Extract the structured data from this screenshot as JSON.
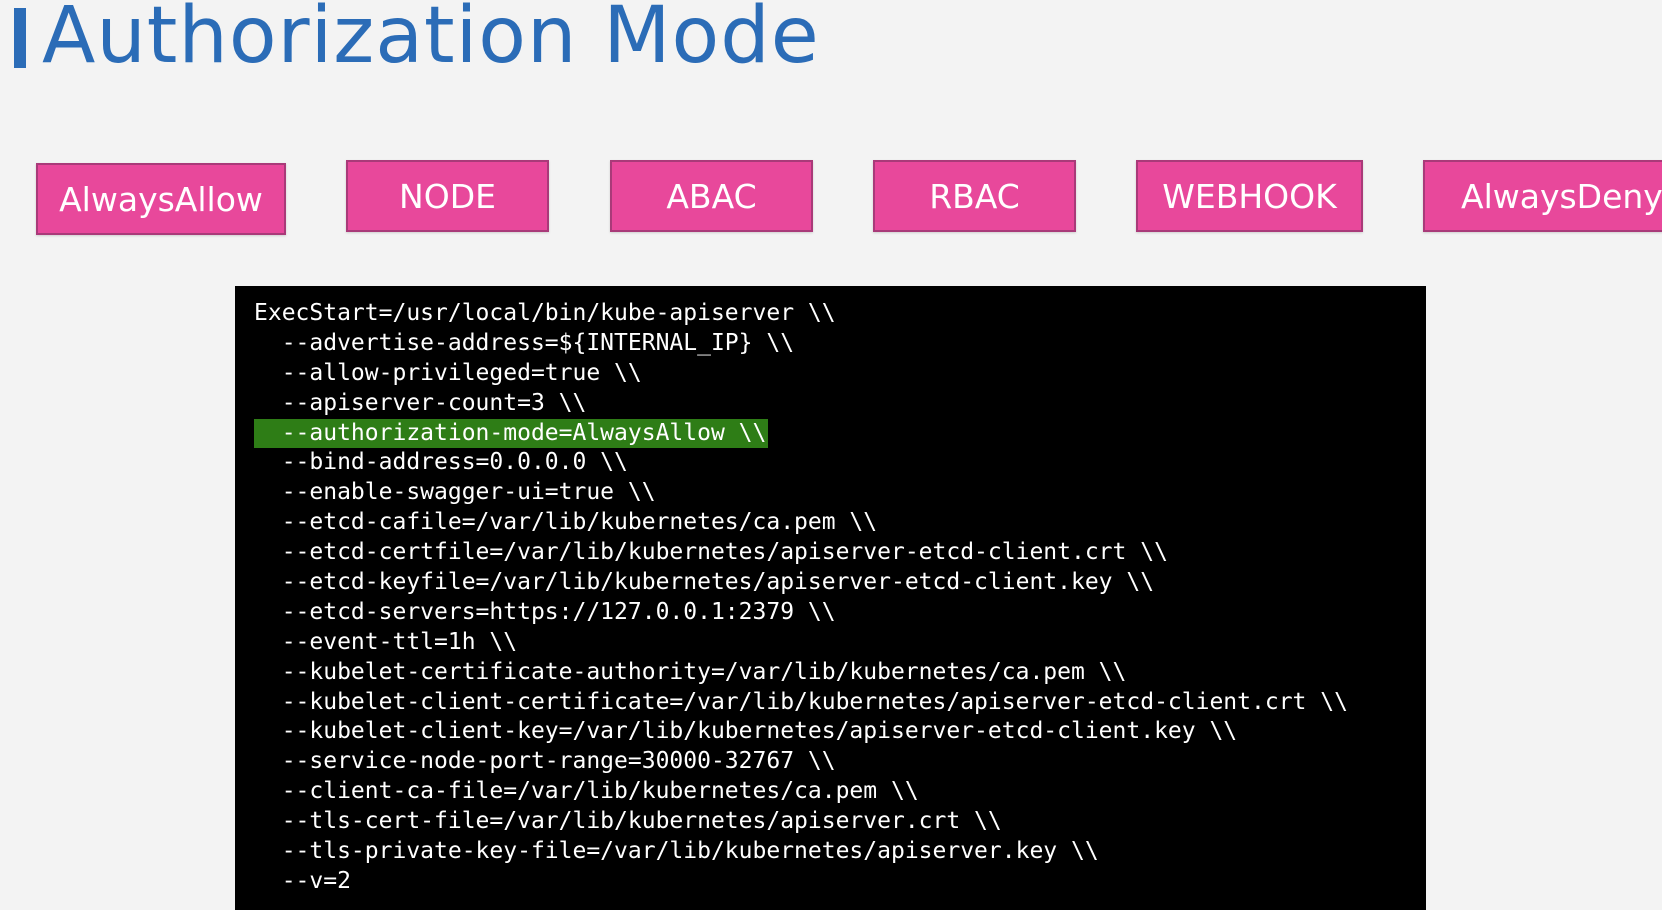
{
  "header": {
    "title": "Authorization Mode",
    "accent_color": "#2b6cb7"
  },
  "modes": {
    "color": "#e8489b",
    "items": [
      {
        "label": "AlwaysAllow"
      },
      {
        "label": "NODE"
      },
      {
        "label": "ABAC"
      },
      {
        "label": "RBAC"
      },
      {
        "label": "WEBHOOK"
      },
      {
        "label": "AlwaysDeny"
      }
    ]
  },
  "terminal": {
    "background": "#000000",
    "highlight_color": "#2e7d16",
    "highlighted_line_index": 4,
    "lines": [
      "ExecStart=/usr/local/bin/kube-apiserver \\\\",
      "  --advertise-address=${INTERNAL_IP} \\\\",
      "  --allow-privileged=true \\\\",
      "  --apiserver-count=3 \\\\",
      "  --authorization-mode=AlwaysAllow \\\\",
      "  --bind-address=0.0.0.0 \\\\",
      "  --enable-swagger-ui=true \\\\",
      "  --etcd-cafile=/var/lib/kubernetes/ca.pem \\\\",
      "  --etcd-certfile=/var/lib/kubernetes/apiserver-etcd-client.crt \\\\",
      "  --etcd-keyfile=/var/lib/kubernetes/apiserver-etcd-client.key \\\\",
      "  --etcd-servers=https://127.0.0.1:2379 \\\\",
      "  --event-ttl=1h \\\\",
      "  --kubelet-certificate-authority=/var/lib/kubernetes/ca.pem \\\\",
      "  --kubelet-client-certificate=/var/lib/kubernetes/apiserver-etcd-client.crt \\\\",
      "  --kubelet-client-key=/var/lib/kubernetes/apiserver-etcd-client.key \\\\",
      "  --service-node-port-range=30000-32767 \\\\",
      "  --client-ca-file=/var/lib/kubernetes/ca.pem \\\\",
      "  --tls-cert-file=/var/lib/kubernetes/apiserver.crt \\\\",
      "  --tls-private-key-file=/var/lib/kubernetes/apiserver.key \\\\",
      "  --v=2"
    ]
  }
}
